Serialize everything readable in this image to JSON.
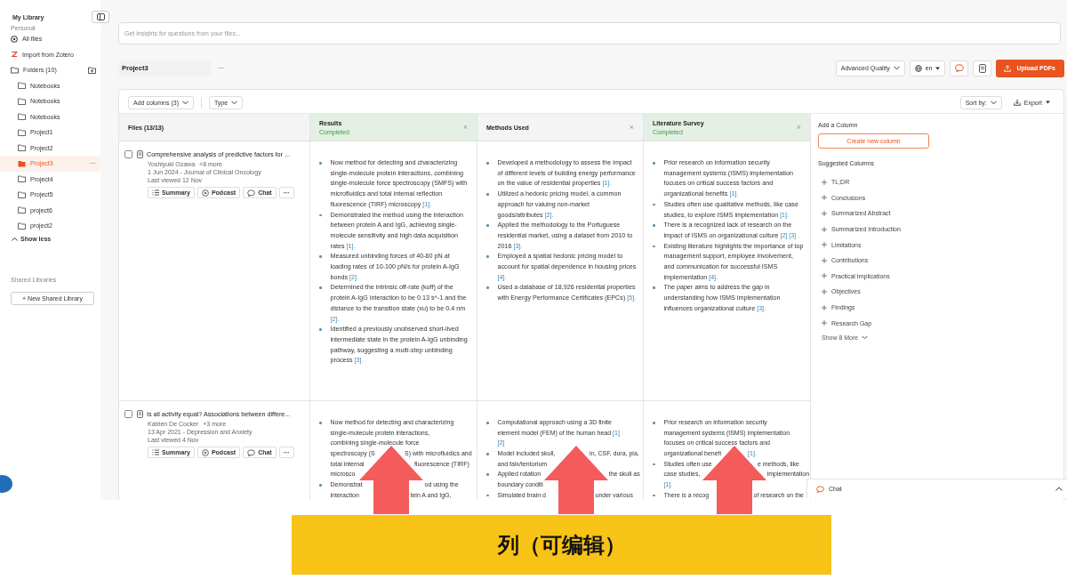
{
  "sidebar": {
    "title": "My Library",
    "section": "Personal",
    "items": [
      {
        "kind": "all-files",
        "label": "All files"
      },
      {
        "kind": "zotero",
        "label": "Import from Zotero"
      },
      {
        "kind": "folders",
        "label": "Folders (10)"
      }
    ],
    "folders": [
      {
        "label": "Notebooks",
        "selected": false
      },
      {
        "label": "Notebooks",
        "selected": false
      },
      {
        "label": "Notebooks",
        "selected": false
      },
      {
        "label": "Project1",
        "selected": false
      },
      {
        "label": "Project2",
        "selected": false
      },
      {
        "label": "Project3",
        "selected": true,
        "more": "···"
      },
      {
        "label": "Project4",
        "selected": false
      },
      {
        "label": "Project5",
        "selected": false
      },
      {
        "label": "project6",
        "selected": false
      },
      {
        "label": "project2",
        "selected": false
      }
    ],
    "show_less": "Show less",
    "shared_title": "Shared Libraries",
    "new_shared": "+ New Shared Library"
  },
  "search": {
    "placeholder": "Get insights for questions from your files..."
  },
  "project": {
    "name": "Project3",
    "more": "···",
    "quality": "Advanced Quality",
    "language": "en",
    "upload": "Upload PDFs"
  },
  "toolbar": {
    "add_columns": "Add columns (3)",
    "type": "Type",
    "sort": "Sort by:",
    "export": "Export"
  },
  "table": {
    "files_header": "Files (13/13)",
    "columns": [
      {
        "title": "Results",
        "status": "Completed",
        "completed": true,
        "close": "×"
      },
      {
        "title": "Methods Used",
        "completed": false,
        "close": "×"
      },
      {
        "title": "Literature Survey",
        "status": "Completed",
        "completed": true,
        "close": "×"
      }
    ],
    "rows": [
      {
        "checked": false,
        "title": "Comprehensive analysis of predictive factors for ...",
        "authors": "Yoshiyuki Ozawa",
        "more_authors": "+8 more",
        "published": "1 Jun 2024 - Journal of Clinical Oncology",
        "viewed": "Last viewed 12 Nov",
        "actions": [
          "Summary",
          "Podcast",
          "Chat",
          "···"
        ],
        "cells": [
          [
            {
              "text": "Now method for detecting and characterizing single-molecule protein interactions, combining single-molecule force spectroscopy (SMFS) with microfluidics and total internal reflection fluorescence (TIRF) microscopy",
              "refs": [
                "[1]."
              ]
            },
            {
              "text": "Demonstrated the method using the interaction between protein A and IgG, achieving single-molecule sensitivity and high data acquisition rates",
              "refs": [
                "[1]."
              ]
            },
            {
              "text": "Measured unbinding forces of 40-60 pN at loading rates of 10-100 pN/s for protein A-IgG bonds",
              "refs": [
                "[2]."
              ]
            },
            {
              "text": "Determined the intrinsic off-rate (koff) of the protein A-IgG interaction to be 0.13 s^-1 and the distance to the transition state (xu) to be 0.4 nm",
              "refs": [
                "[2]."
              ]
            },
            {
              "text": "Identified a previously unobserved short-lived intermediate state in the protein A-IgG unbinding pathway, suggesting a multi-step unbinding process",
              "refs": [
                "[3]."
              ]
            }
          ],
          [
            {
              "text": "Developed a methodology to assess the impact of different levels of building energy performance on the value of residential properties",
              "refs": [
                "[1]."
              ]
            },
            {
              "text": "Utilized a hedonic pricing model, a common approach for valuing non-market goods/attributes",
              "refs": [
                "[2]."
              ]
            },
            {
              "text": "Applied the methodology to the Portuguese residential market, using a dataset from 2010 to 2016",
              "refs": [
                "[3]."
              ]
            },
            {
              "text": "Employed a spatial hedonic pricing model to account for spatial dependence in housing prices",
              "refs": [
                "[4]."
              ]
            },
            {
              "text": "Used a database of 18,926 residential properties with Energy Performance Certificates (EPCs)",
              "refs": [
                "[5]."
              ]
            }
          ],
          [
            {
              "text": "Prior research on information security management systems (ISMS) implementation focuses on critical success factors and organizational benefits",
              "refs": [
                "[1]."
              ]
            },
            {
              "text": "Studies often use qualitative methods, like case studies, to explore ISMS implementation",
              "refs": [
                "[1]."
              ]
            },
            {
              "text": "There is a recognized lack of research on the impact of ISMS on organizational culture",
              "refs": [
                "[2]",
                "[3]",
                "."
              ]
            },
            {
              "text": "Existing literature highlights the importance of top management support, employee involvement, and communication for successful ISMS implementation",
              "refs": [
                "[4]."
              ]
            },
            {
              "text": "The paper aims to address the gap in understanding how ISMS implementation influences organizational culture",
              "refs": [
                "[3]."
              ]
            }
          ]
        ]
      },
      {
        "checked": false,
        "title": "Is all activity equal? Associations between differe...",
        "authors": "Katrien De Cocker",
        "more_authors": "+3 more",
        "published": "13 Apr 2021 - Depression and Anxiety",
        "viewed": "Last viewed 4 Nov",
        "actions": [
          "Summary",
          "Podcast",
          "Chat",
          "···"
        ],
        "cells": [
          [
            {
              "lines": [
                {
                  "before": [
                    {
                      "text": "Now method for detecting and characterizing"
                    }
                  ]
                },
                {
                  "before": [
                    {
                      "text": "single-molecule protein interactions,"
                    }
                  ]
                },
                {
                  "before": [
                    {
                      "text": "combining single-molecule force"
                    }
                  ]
                },
                {
                  "before": [
                    {
                      "text": "spectroscopy (S"
                    }
                  ],
                  "after": [
                    {
                      "text": "S) with microfluidics and"
                    }
                  ]
                },
                {
                  "before": [
                    {
                      "text": "total internal"
                    }
                  ],
                  "after": [
                    {
                      "text": "fluorescence (TIRF)"
                    }
                  ]
                },
                {
                  "before": [
                    {
                      "text": "microsco"
                    }
                  ]
                }
              ]
            },
            {
              "lines": [
                {
                  "before": [
                    {
                      "text": "Demonstrat"
                    }
                  ],
                  "after": [
                    {
                      "text": "od using the"
                    }
                  ]
                },
                {
                  "before": [
                    {
                      "text": "interaction"
                    }
                  ],
                  "after": [
                    {
                      "text": "tein A and IgG,"
                    }
                  ]
                }
              ]
            }
          ],
          [
            {
              "lines": [
                {
                  "before": [
                    {
                      "text": "Computational approach using a 3D finite"
                    }
                  ]
                },
                {
                  "before": [
                    {
                      "text": "element model (FEM) of the human head"
                    },
                    {
                      "ref": "[1]"
                    }
                  ]
                },
                {
                  "before": [
                    {
                      "ref": "[2]"
                    }
                  ]
                }
              ]
            },
            {
              "lines": [
                {
                  "before": [
                    {
                      "text": "Model included skull,"
                    }
                  ],
                  "after": [
                    {
                      "text": "in, CSF, dura, pia,"
                    }
                  ]
                },
                {
                  "before": [
                    {
                      "text": "and falx/tentorium"
                    }
                  ]
                }
              ]
            },
            {
              "lines": [
                {
                  "before": [
                    {
                      "text": "Applied rotation"
                    }
                  ],
                  "after": [
                    {
                      "text": "the skull as"
                    }
                  ]
                },
                {
                  "before": [
                    {
                      "text": "boundary conditi"
                    }
                  ]
                }
              ]
            },
            {
              "lines": [
                {
                  "before": [
                    {
                      "text": "Simulated brain d"
                    }
                  ],
                  "after": [
                    {
                      "text": "under various"
                    }
                  ]
                }
              ]
            }
          ],
          [
            {
              "lines": [
                {
                  "before": [
                    {
                      "text": "Prior research on information security"
                    }
                  ]
                },
                {
                  "before": [
                    {
                      "text": "management systems (ISMS) implementation"
                    }
                  ]
                },
                {
                  "before": [
                    {
                      "text": "focuses on critical success factors and"
                    }
                  ]
                },
                {
                  "before": [
                    {
                      "text": "organizational benefi"
                    }
                  ],
                  "after": [
                    {
                      "ref": "[1]."
                    }
                  ]
                }
              ]
            },
            {
              "lines": [
                {
                  "before": [
                    {
                      "text": "Studies often use"
                    }
                  ],
                  "after": [
                    {
                      "text": "e methods, like"
                    }
                  ]
                },
                {
                  "before": [
                    {
                      "text": "case studies,"
                    }
                  ],
                  "after": [
                    {
                      "text": "implementation"
                    }
                  ]
                },
                {
                  "before": [
                    {
                      "ref": "[1]."
                    }
                  ]
                }
              ]
            },
            {
              "lines": [
                {
                  "before": [
                    {
                      "text": "There is a recog"
                    }
                  ],
                  "after": [
                    {
                      "text": "of research on the"
                    }
                  ]
                }
              ]
            }
          ]
        ]
      }
    ]
  },
  "add_column": {
    "title": "Add a Column",
    "create": "Create new column",
    "suggested_title": "Suggested Columns",
    "suggested": [
      "TL;DR",
      "Conclusions",
      "Summarized Abstract",
      "Summarized Introduction",
      "Limitations",
      "Contributions",
      "Practical Implications",
      "Objectives",
      "Findings",
      "Research Gap"
    ],
    "show_more": "Show 8 More"
  },
  "chat": {
    "label": "Chat"
  },
  "annotation": {
    "banner": "列（可编辑）",
    "arrows": [
      {
        "kind": "up-arrow"
      },
      {
        "kind": "up-arrow"
      },
      {
        "kind": "up-arrow"
      }
    ]
  }
}
